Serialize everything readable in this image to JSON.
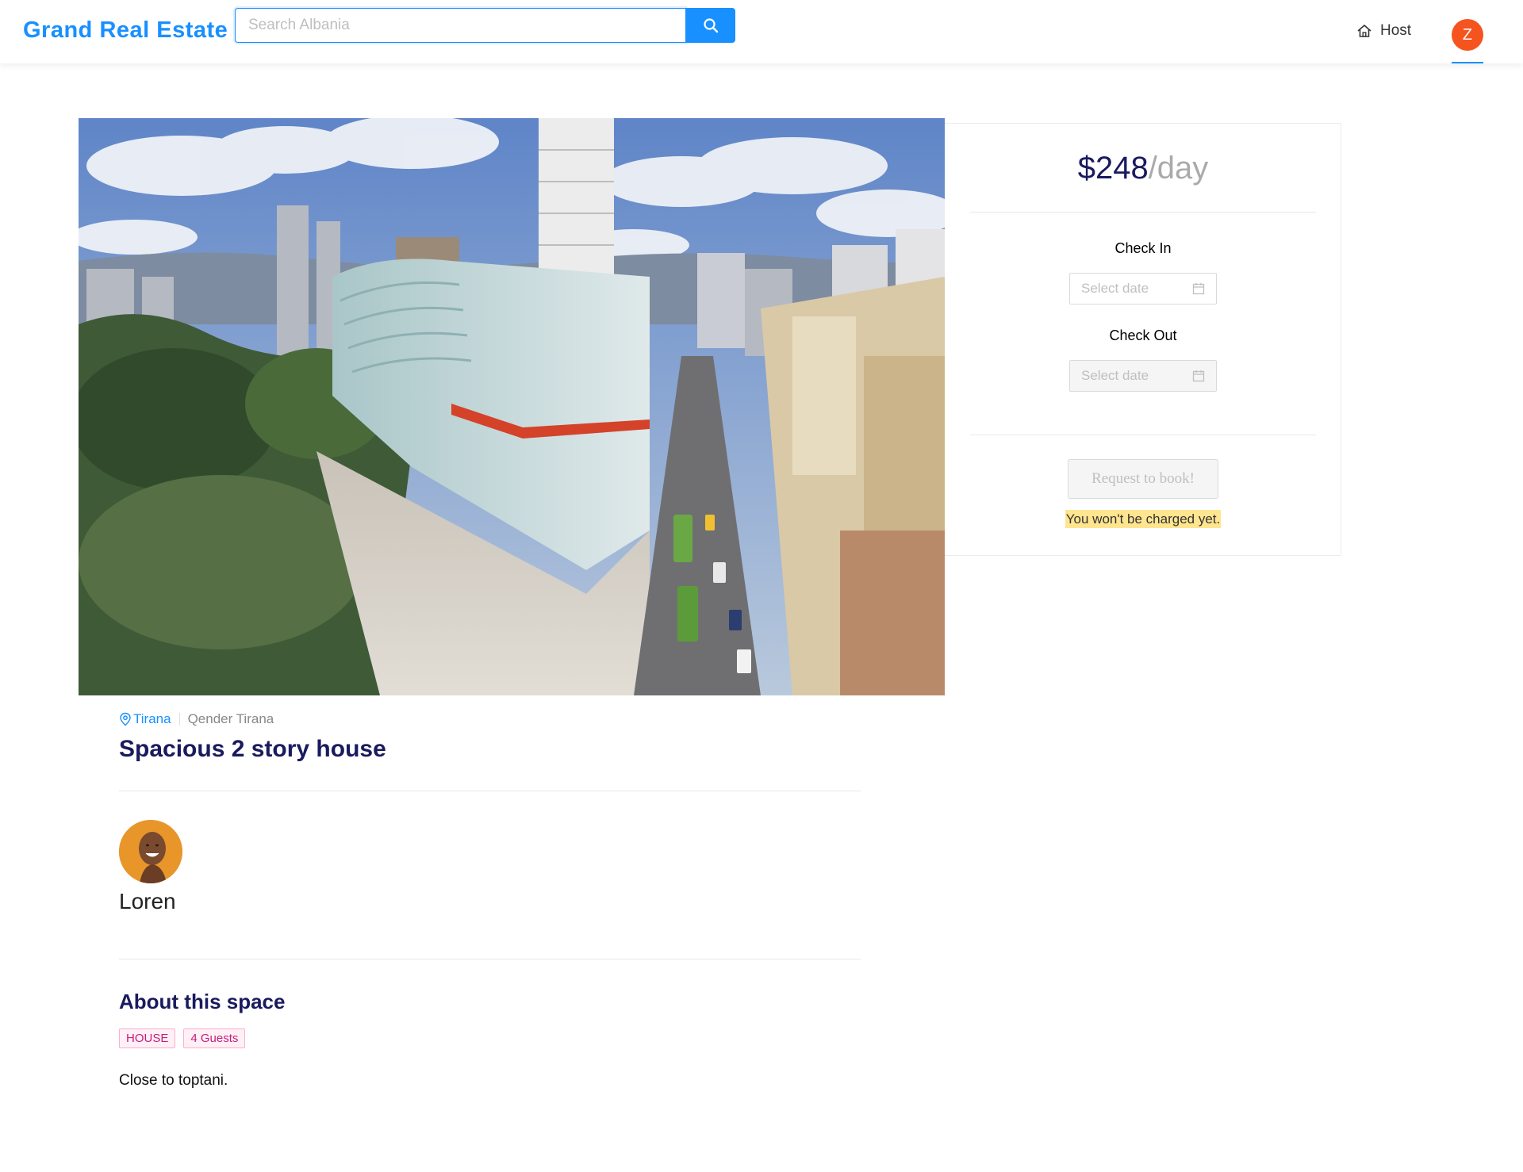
{
  "header": {
    "logo": "Grand Real Estate",
    "search": {
      "placeholder": "Search Albania",
      "value": ""
    },
    "host_label": "Host",
    "user_initial": "Z"
  },
  "listing": {
    "city": "Tirana",
    "area": "Qender Tirana",
    "title": "Spacious 2 story house",
    "host_name": "Loren",
    "about_title": "About this space",
    "tags": [
      "HOUSE",
      "4 Guests"
    ],
    "description": "Close to toptani."
  },
  "booking": {
    "price": "$248",
    "price_unit": "/day",
    "check_in_label": "Check In",
    "check_in_placeholder": "Select date",
    "check_out_label": "Check Out",
    "check_out_placeholder": "Select date",
    "button_label": "Request to book!",
    "note": "You won't be charged yet."
  },
  "colors": {
    "primary": "#1890ff",
    "title_navy": "#1a1a5e",
    "avatar_orange": "#f5541e",
    "tag_magenta": "#c41d7f",
    "highlight_yellow": "#ffe58f"
  }
}
